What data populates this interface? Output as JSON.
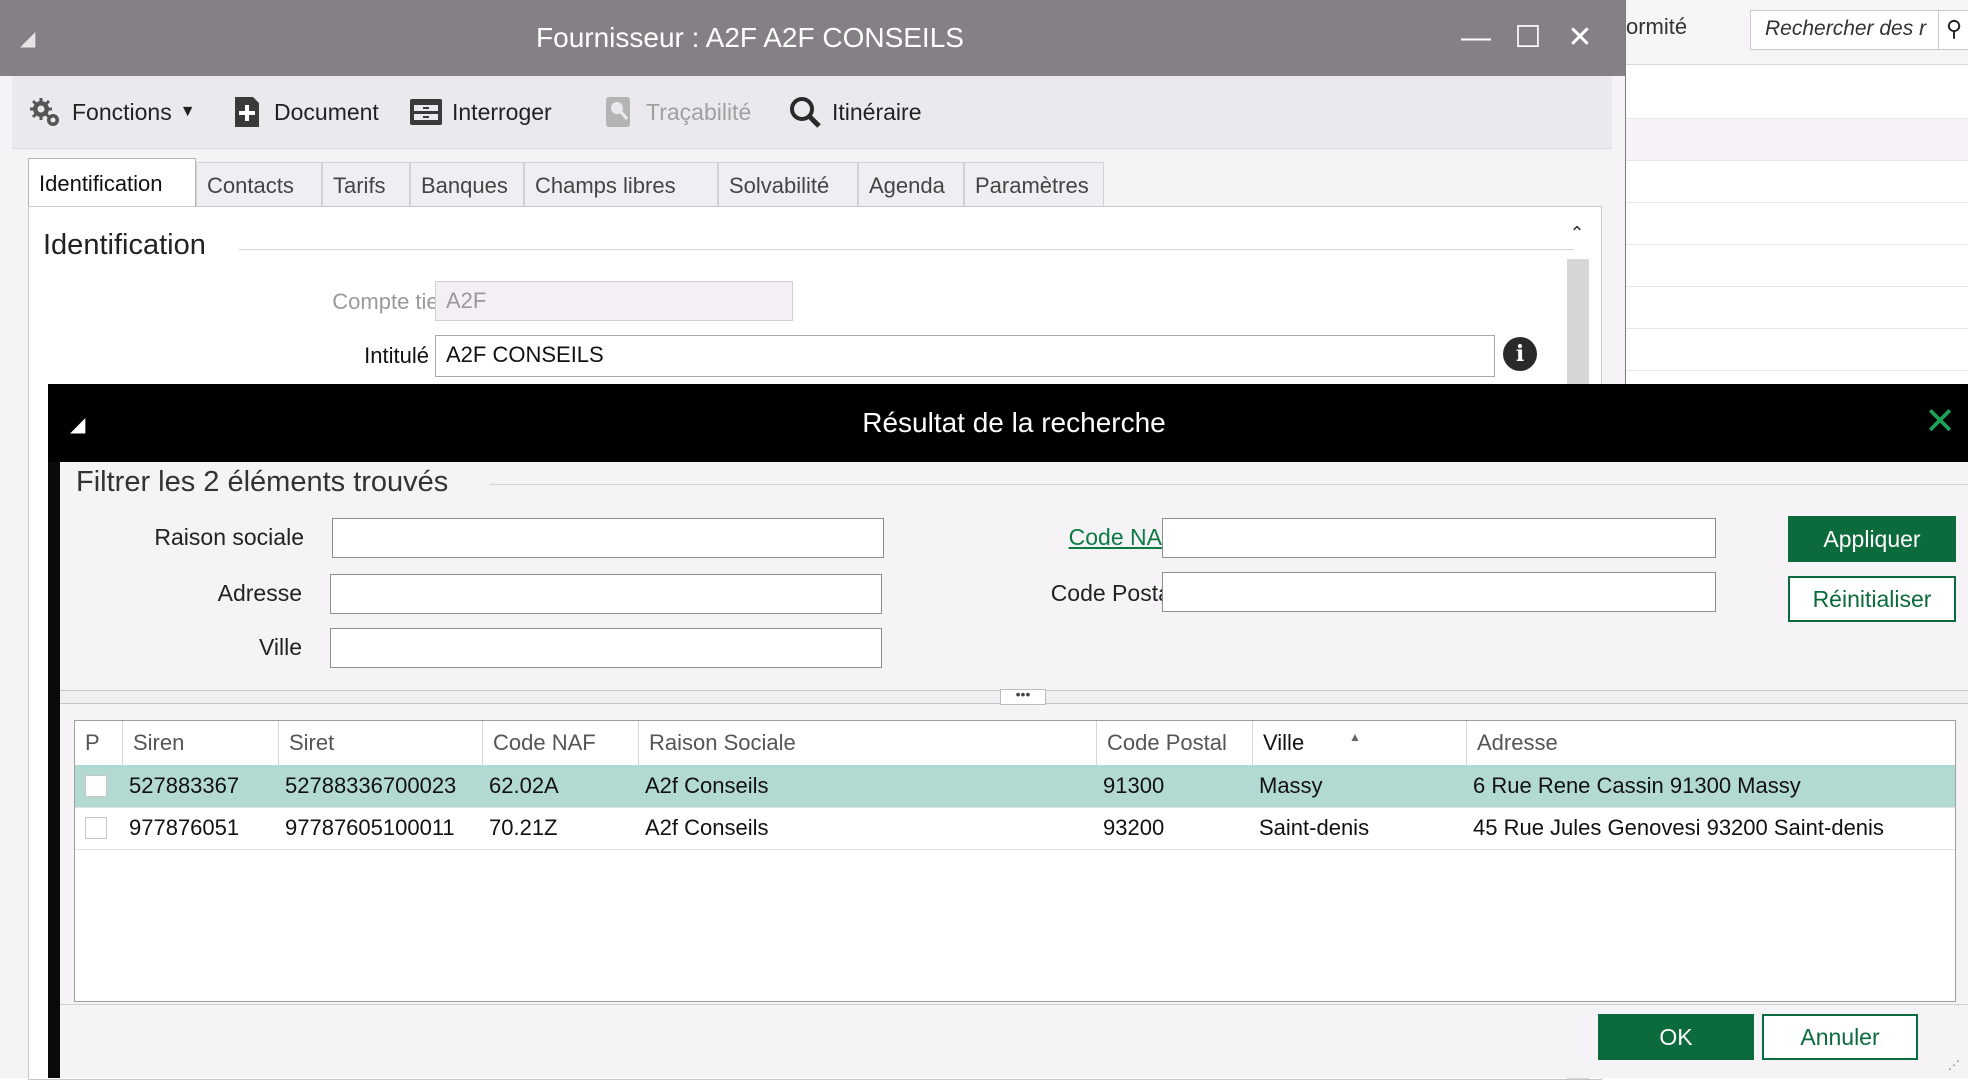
{
  "background_app": {
    "conformite_text": "ormité",
    "search_placeholder": "Rechercher des r"
  },
  "supplier_window": {
    "title": "Fournisseur : A2F A2F CONSEILS",
    "toolbar": {
      "fonctions": "Fonctions",
      "document": "Document",
      "interroger": "Interroger",
      "tracabilite": "Traçabilité",
      "itineraire": "Itinéraire"
    },
    "tabs": [
      "Identification",
      "Contacts",
      "Tarifs",
      "Banques",
      "Champs libres",
      "Solvabilité",
      "Agenda",
      "Paramètres"
    ],
    "section_title": "Identification",
    "compte_tiers_label": "Compte tiers",
    "compte_tiers_value": "A2F",
    "intitule_label": "Intitulé",
    "intitule_value": "A2F CONSEILS"
  },
  "search_dialog": {
    "title": "Résultat de la recherche",
    "filter_title": "Filtrer les 2 éléments trouvés",
    "labels": {
      "raison_sociale": "Raison sociale",
      "adresse": "Adresse",
      "ville": "Ville",
      "code_naf": "Code NAF",
      "code_postal": "Code Postal"
    },
    "buttons": {
      "appliquer": "Appliquer",
      "reinitialiser": "Réinitialiser",
      "ok": "OK",
      "annuler": "Annuler"
    },
    "splitter_grip": "•••",
    "columns": [
      "P",
      "Siren",
      "Siret",
      "Code NAF",
      "Raison Sociale",
      "Code Postal",
      "Ville",
      "Adresse"
    ],
    "rows": [
      {
        "siren": "527883367",
        "siret": "52788336700023",
        "naf": "62.02A",
        "raison": "A2f Conseils",
        "cp": "91300",
        "ville": "Massy",
        "adresse": "6 Rue Rene Cassin 91300 Massy",
        "selected": true
      },
      {
        "siren": "977876051",
        "siret": "97787605100011",
        "naf": "70.21Z",
        "raison": "A2f Conseils",
        "cp": "93200",
        "ville": "Saint-denis",
        "adresse": "45 Rue Jules Genovesi 93200 Saint-denis",
        "selected": false
      }
    ]
  },
  "colors": {
    "accent_green": "#0b6b3d",
    "selected_row": "#b3d9d3",
    "window_title": "#857f86",
    "dialog_title": "#000000"
  }
}
